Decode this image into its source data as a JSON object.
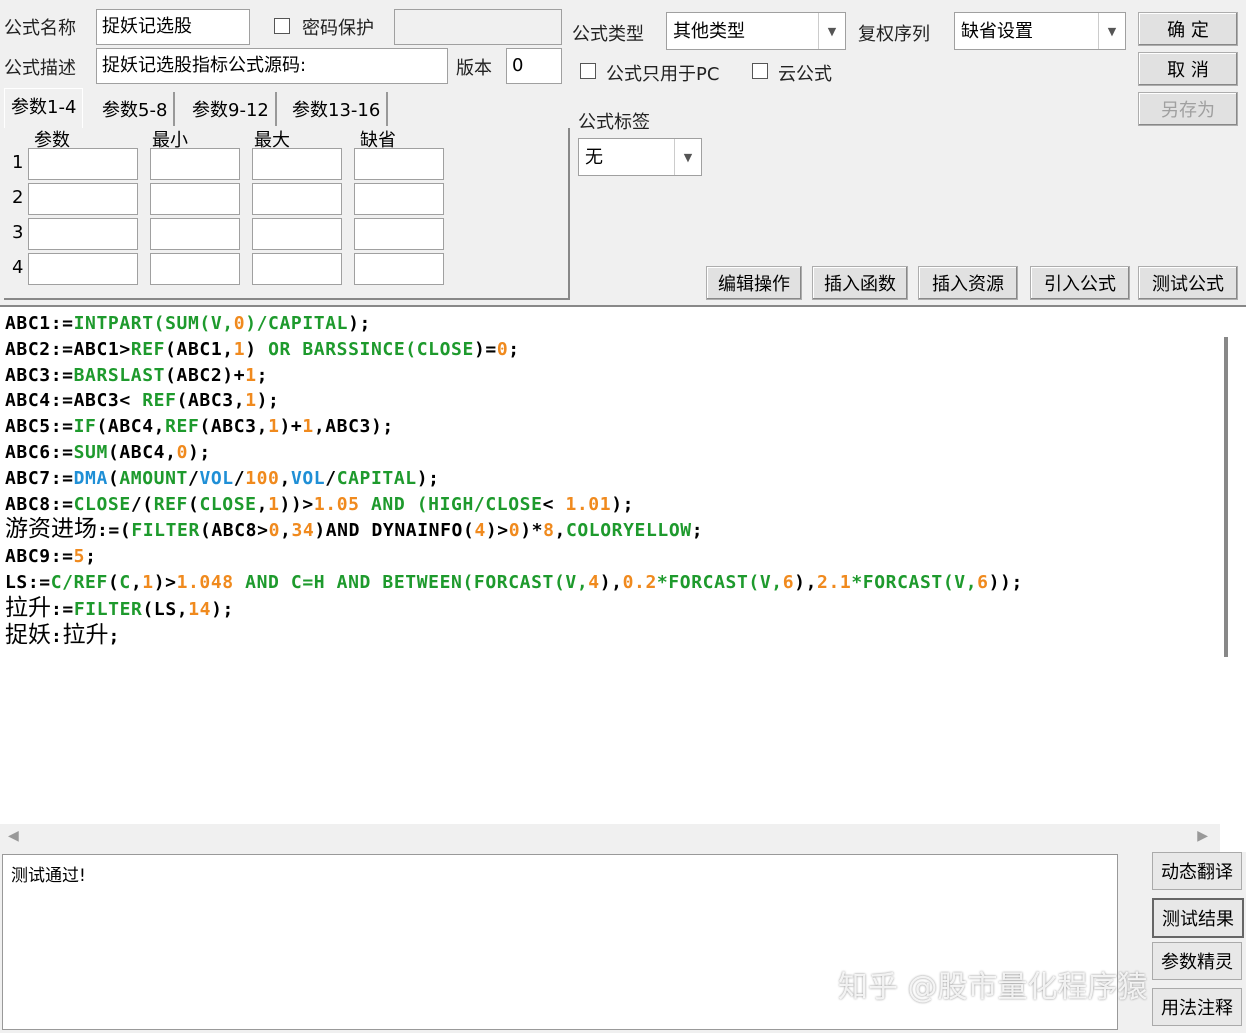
{
  "form": {
    "name_label": "公式名称",
    "name_value": "捉妖记选股",
    "password_label": "密码保护",
    "password_value": "",
    "desc_label": "公式描述",
    "desc_value": "捉妖记选股指标公式源码:",
    "version_label": "版本",
    "version_value": "0",
    "type_label": "公式类型",
    "type_value": "其他类型",
    "rights_label": "复权序列",
    "rights_value": "缺省设置",
    "pc_only_label": "公式只用于PC",
    "cloud_label": "云公式",
    "tag_label": "公式标签",
    "tag_value": "无"
  },
  "buttons": {
    "ok": "确 定",
    "cancel": "取 消",
    "save_as": "另存为",
    "edit": "编辑操作",
    "insert_func": "插入函数",
    "insert_res": "插入资源",
    "import": "引入公式",
    "test": "测试公式"
  },
  "tabs": [
    "参数1-4",
    "参数5-8",
    "参数9-12",
    "参数13-16"
  ],
  "param_headers": [
    "参数",
    "最小",
    "最大",
    "缺省"
  ],
  "param_rows": [
    "1",
    "2",
    "3",
    "4"
  ],
  "code_lines": [
    [
      [
        "ABC1:=",
        "k"
      ],
      [
        "INTPART(SUM(V,",
        "g"
      ],
      [
        "0",
        "o"
      ],
      [
        ")/CAPITAL",
        "g"
      ],
      [
        ");",
        "k"
      ]
    ],
    [
      [
        "ABC2:=ABC1>",
        "k"
      ],
      [
        "REF",
        "g"
      ],
      [
        "(ABC1,",
        "k"
      ],
      [
        "1",
        "o"
      ],
      [
        ") ",
        "k"
      ],
      [
        "OR BARSSINCE(CLOSE",
        "g"
      ],
      [
        ")=",
        "k"
      ],
      [
        "0",
        "o"
      ],
      [
        ";",
        "k"
      ]
    ],
    [
      [
        "ABC3:=",
        "k"
      ],
      [
        "BARSLAST",
        "g"
      ],
      [
        "(ABC2)+",
        "k"
      ],
      [
        "1",
        "o"
      ],
      [
        ";",
        "k"
      ]
    ],
    [
      [
        "ABC4:=ABC3< ",
        "k"
      ],
      [
        "REF",
        "g"
      ],
      [
        "(ABC3,",
        "k"
      ],
      [
        "1",
        "o"
      ],
      [
        ");",
        "k"
      ]
    ],
    [
      [
        "ABC5:=",
        "k"
      ],
      [
        "IF",
        "g"
      ],
      [
        "(ABC4,",
        "k"
      ],
      [
        "REF",
        "g"
      ],
      [
        "(ABC3,",
        "k"
      ],
      [
        "1",
        "o"
      ],
      [
        ")+",
        "k"
      ],
      [
        "1",
        "o"
      ],
      [
        ",ABC3);",
        "k"
      ]
    ],
    [
      [
        "ABC6:=",
        "k"
      ],
      [
        "SUM",
        "g"
      ],
      [
        "(ABC4,",
        "k"
      ],
      [
        "0",
        "o"
      ],
      [
        ");",
        "k"
      ]
    ],
    [
      [
        "ABC7:=",
        "k"
      ],
      [
        "DMA",
        "b"
      ],
      [
        "(",
        "k"
      ],
      [
        "AMOUNT",
        "g"
      ],
      [
        "/",
        "k"
      ],
      [
        "VOL",
        "b"
      ],
      [
        "/",
        "k"
      ],
      [
        "100",
        "o"
      ],
      [
        ",",
        "k"
      ],
      [
        "VOL",
        "b"
      ],
      [
        "/",
        "k"
      ],
      [
        "CAPITAL",
        "g"
      ],
      [
        ");",
        "k"
      ]
    ],
    [
      [
        "ABC8:=",
        "k"
      ],
      [
        "CLOSE",
        "g"
      ],
      [
        "/(",
        "k"
      ],
      [
        "REF",
        "g"
      ],
      [
        "(",
        "k"
      ],
      [
        "CLOSE",
        "g"
      ],
      [
        ",",
        "k"
      ],
      [
        "1",
        "o"
      ],
      [
        "))>",
        "k"
      ],
      [
        "1.",
        "o"
      ],
      [
        "05",
        "o"
      ],
      [
        " AND (HIGH/CLOSE",
        "g"
      ],
      [
        "< ",
        "k"
      ],
      [
        "1.01",
        "o"
      ],
      [
        ");",
        "k"
      ]
    ],
    [
      [
        "游资进场",
        "cn"
      ],
      [
        ":=(",
        "k"
      ],
      [
        "FILTER",
        "g"
      ],
      [
        "(ABC8>",
        "k"
      ],
      [
        "0",
        "o"
      ],
      [
        ",",
        "k"
      ],
      [
        "34",
        "o"
      ],
      [
        ")AND DYNAINFO(",
        "k"
      ],
      [
        "4",
        "o"
      ],
      [
        ")>",
        "k"
      ],
      [
        "0",
        "o"
      ],
      [
        ")*",
        "k"
      ],
      [
        "8",
        "o"
      ],
      [
        ",",
        "k"
      ],
      [
        "COLORYELLOW",
        "g"
      ],
      [
        ";",
        "k"
      ]
    ],
    [
      [
        "ABC9:=",
        "k"
      ],
      [
        "5",
        "o"
      ],
      [
        ";",
        "k"
      ]
    ],
    [
      [
        "LS:=",
        "k"
      ],
      [
        "C/REF",
        "g"
      ],
      [
        "(",
        "k"
      ],
      [
        "C",
        "g"
      ],
      [
        ",",
        "k"
      ],
      [
        "1",
        "o"
      ],
      [
        ")>",
        "k"
      ],
      [
        "1.048",
        "o"
      ],
      [
        " AND C=H AND BETWEEN(FORCAST(V,",
        "g"
      ],
      [
        "4",
        "o"
      ],
      [
        "),",
        "k"
      ],
      [
        "0.2",
        "o"
      ],
      [
        "*FORCAST(V,",
        "g"
      ],
      [
        "6",
        "o"
      ],
      [
        "),",
        "k"
      ],
      [
        "2.1",
        "o"
      ],
      [
        "*FORCAST(V,",
        "g"
      ],
      [
        "6",
        "o"
      ],
      [
        "));",
        "k"
      ]
    ],
    [
      [
        "拉升",
        "cn"
      ],
      [
        ":=",
        "k"
      ],
      [
        "FILTER",
        "g"
      ],
      [
        "(LS,",
        "k"
      ],
      [
        "14",
        "o"
      ],
      [
        ");",
        "k"
      ]
    ],
    [
      [
        "捉妖",
        "cn"
      ],
      [
        ":",
        "k"
      ],
      [
        "拉升",
        "cn"
      ],
      [
        ";",
        "k"
      ]
    ]
  ],
  "message": "测试通过!",
  "side_buttons": [
    "动态翻译",
    "测试结果",
    "参数精灵",
    "用法注释"
  ],
  "watermark": "知乎 @股市量化程序猿"
}
